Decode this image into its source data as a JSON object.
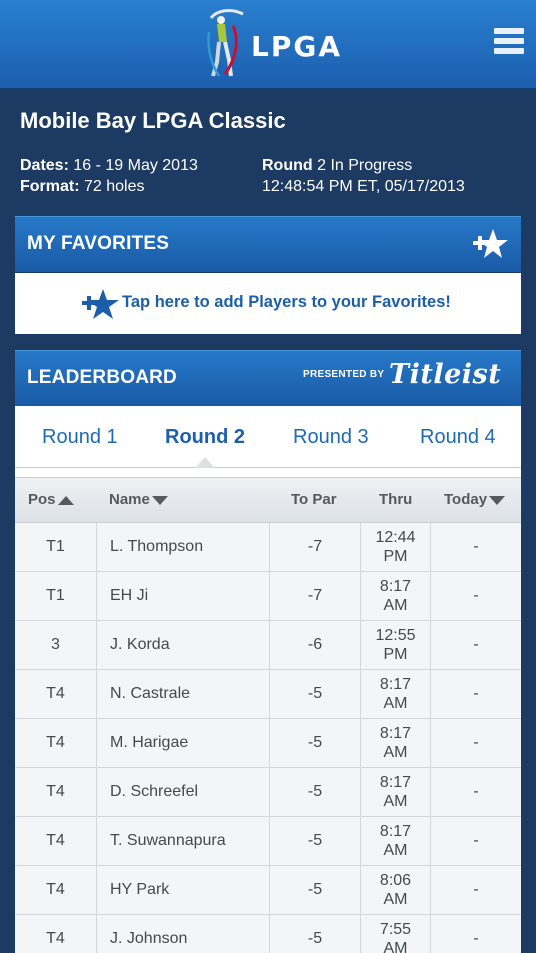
{
  "header": {
    "logo_text": "LPGA",
    "menu_icon": "hamburger-menu-icon",
    "brand_color": "#1b5fae"
  },
  "tournament": {
    "title": "Mobile Bay LPGA Classic",
    "dates_label": "Dates:",
    "dates_value": " 16 - 19 May 2013",
    "format_label": "Format:",
    "format_value": " 72 holes",
    "round_label": "Round",
    "round_value": " 2 In Progress",
    "updated": "12:48:54 PM ET, 05/17/2013"
  },
  "favorites": {
    "title": "MY FAVORITES",
    "add_text": "Tap here to add Players to your Favorites!",
    "icon": "add-favorite-star-icon"
  },
  "leaderboard": {
    "title": "LEADERBOARD",
    "presented_by": "PRESENTED BY",
    "sponsor": "Titleist",
    "tabs": [
      "Round 1",
      "Round 2",
      "Round 3",
      "Round 4"
    ],
    "active_tab": 1,
    "columns": {
      "pos": "Pos",
      "name": "Name",
      "to_par": "To Par",
      "thru": "Thru",
      "today": "Today"
    },
    "rows": [
      {
        "pos": "T1",
        "name": "L. Thompson",
        "to_par": "-7",
        "thru": "12:44 PM",
        "today": "-"
      },
      {
        "pos": "T1",
        "name": "EH Ji",
        "to_par": "-7",
        "thru": "8:17 AM",
        "today": "-"
      },
      {
        "pos": "3",
        "name": "J. Korda",
        "to_par": "-6",
        "thru": "12:55 PM",
        "today": "-"
      },
      {
        "pos": "T4",
        "name": "N. Castrale",
        "to_par": "-5",
        "thru": "8:17 AM",
        "today": "-"
      },
      {
        "pos": "T4",
        "name": "M. Harigae",
        "to_par": "-5",
        "thru": "8:17 AM",
        "today": "-"
      },
      {
        "pos": "T4",
        "name": "D. Schreefel",
        "to_par": "-5",
        "thru": "8:17 AM",
        "today": "-"
      },
      {
        "pos": "T4",
        "name": "T. Suwannapura",
        "to_par": "-5",
        "thru": "8:17 AM",
        "today": "-"
      },
      {
        "pos": "T4",
        "name": "HY Park",
        "to_par": "-5",
        "thru": "8:06 AM",
        "today": "-"
      },
      {
        "pos": "T4",
        "name": "J. Johnson",
        "to_par": "-5",
        "thru": "7:55 AM",
        "today": "-"
      }
    ]
  }
}
